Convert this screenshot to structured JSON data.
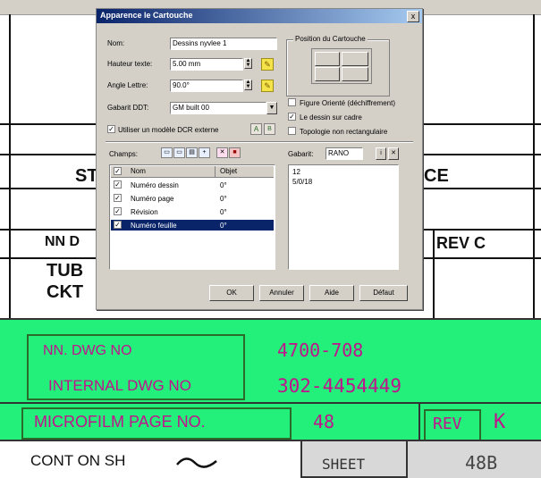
{
  "drawing": {
    "sheet_fragment_left": "ST",
    "sheet_fragment_right": "CE",
    "nn_fragment": "NN D",
    "rev_fragment": "REV C",
    "tube_fragment": "TUB",
    "ckt_fragment": "CKT",
    "nn_dwg_label": "NN. DWG NO",
    "nn_dwg_value": "4700-708",
    "internal_dwg_label": "INTERNAL DWG NO",
    "internal_dwg_value": "302-4454449",
    "microfilm_label": "MICROFILM PAGE NO.",
    "microfilm_value": "48",
    "rev_label": "REV",
    "rev_value": "K",
    "cont_label": "CONT ON SH",
    "sheet_label": "SHEET",
    "sheet_value": "48B"
  },
  "dialog": {
    "title": "Apparence le Cartouche",
    "close_label": "x",
    "name_label": "Nom:",
    "name_value": "Dessins nyvlee 1",
    "height_label": "Hauteur texte:",
    "height_value": "5.00 mm",
    "angle_label": "Angle Lettre:",
    "angle_value": "90.0°",
    "gabarit_label": "Gabarit DDT:",
    "gabarit_value": "GM built 00",
    "use_label": "Utiliser un modèle DCR externe",
    "position_group": "Position du Cartouche",
    "opt_figure": "Figure Orienté (déchiffrement)",
    "opt_border": "Le dessin sur cadre",
    "opt_topology": "Topologie non rectangulaire",
    "fields_label": "Champs:",
    "col_name": "Nom",
    "col_object": "Objet",
    "rows": [
      {
        "name": "Numéro dessin",
        "object": "0°"
      },
      {
        "name": "Numéro page",
        "object": "0°"
      },
      {
        "name": "Révision",
        "object": "0°"
      },
      {
        "name": "Numéro feuille",
        "object": "0°"
      }
    ],
    "gabarit_list_label": "Gabarit:",
    "gabarit_list_value": "RANO",
    "gabarit_items": [
      "12",
      "5/0/18"
    ],
    "ok_label": "OK",
    "cancel_label": "Annuler",
    "help_label": "Aide",
    "default_label": "Défaut"
  }
}
